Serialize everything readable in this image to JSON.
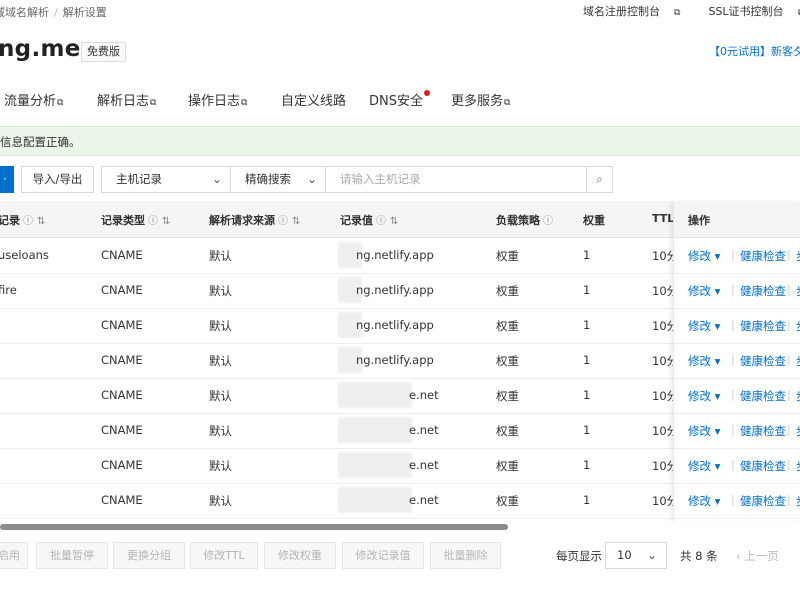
{
  "breadcrumb": [
    "域域名解析",
    "解析设置"
  ],
  "top_links": [
    "域名注册控制台",
    "SSL证书控制台"
  ],
  "domain": {
    "name": "ng.me",
    "badge": "免费版"
  },
  "trial_link": "【0元试用】新客夕",
  "tabs": [
    {
      "label": "流量分析",
      "external": true
    },
    {
      "label": "解析日志",
      "external": true
    },
    {
      "label": "操作日志",
      "external": true
    },
    {
      "label": "自定义线路",
      "external": false
    },
    {
      "label": "DNS安全",
      "external": false,
      "dot": true
    },
    {
      "label": "更多服务",
      "external": true
    }
  ],
  "alert": "信息配置正确。",
  "toolbar": {
    "add_label": "·",
    "import_export": "导入/导出",
    "record_type_select": "主机记录",
    "search_mode_select": "精确搜索",
    "search_placeholder": "请输入主机记录"
  },
  "table": {
    "headers": {
      "host": "记录",
      "type": "记录类型",
      "source": "解析请求来源",
      "value": "记录值",
      "policy": "负载策略",
      "weight": "权重",
      "ttl": "TTL",
      "ops": "操作"
    },
    "rows": [
      {
        "host": "useloans",
        "type": "CNAME",
        "source": "默认",
        "value": "ng.netlify.app",
        "policy": "权重",
        "weight": "1",
        "ttl": "10分"
      },
      {
        "host": "fire",
        "type": "CNAME",
        "source": "默认",
        "value": "ng.netlify.app",
        "policy": "权重",
        "weight": "1",
        "ttl": "10分"
      },
      {
        "host": "",
        "type": "CNAME",
        "source": "默认",
        "value": "ng.netlify.app",
        "policy": "权重",
        "weight": "1",
        "ttl": "10分"
      },
      {
        "host": "",
        "type": "CNAME",
        "source": "默认",
        "value": "ng.netlify.app",
        "policy": "权重",
        "weight": "1",
        "ttl": "10分"
      },
      {
        "host": "",
        "type": "CNAME",
        "source": "默认",
        "value": "e.net",
        "policy": "权重",
        "weight": "1",
        "ttl": "10分"
      },
      {
        "host": "",
        "type": "CNAME",
        "source": "默认",
        "value": "e.net",
        "policy": "权重",
        "weight": "1",
        "ttl": "10分"
      },
      {
        "host": "",
        "type": "CNAME",
        "source": "默认",
        "value": "e.net",
        "policy": "权重",
        "weight": "1",
        "ttl": "10分"
      },
      {
        "host": "",
        "type": "CNAME",
        "source": "默认",
        "value": "e.net",
        "policy": "权重",
        "weight": "1",
        "ttl": "10分"
      }
    ],
    "op_modify": "修改 ▾",
    "op_health": "健康检查",
    "op_more": "步"
  },
  "batch_buttons": [
    "启用",
    "批量暂停",
    "更换分组",
    "修改TTL",
    "修改权重",
    "修改记录值",
    "批量删除"
  ],
  "pagination": {
    "page_size_label": "每页显示",
    "page_size": "10",
    "total": "共 8 条",
    "prev": "上一页"
  },
  "colors": {
    "primary": "#0070cc",
    "alert_bg": "#eaf6e8",
    "badge_dot": "#e02020"
  }
}
